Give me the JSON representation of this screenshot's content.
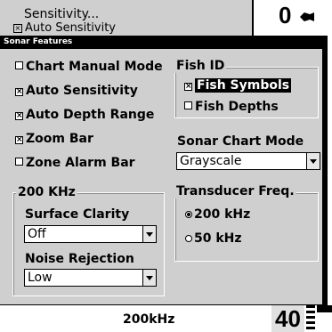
{
  "background_menu": {
    "item1": "Sensitivity...",
    "item2": "Auto Sensitivity",
    "depth_value": "0"
  },
  "dialog": {
    "title": "Sonar Features",
    "chart_manual_mode": {
      "label": "Chart Manual Mode",
      "checked": false
    },
    "auto_sensitivity": {
      "label": "Auto Sensitivity",
      "checked": true
    },
    "auto_depth_range": {
      "label": "Auto Depth Range",
      "checked": true
    },
    "zoom_bar": {
      "label": "Zoom Bar",
      "checked": true
    },
    "zone_alarm_bar": {
      "label": "Zone Alarm Bar",
      "checked": false
    },
    "fish_id": {
      "title": "Fish ID",
      "fish_symbols": {
        "label": "Fish Symbols",
        "checked": true
      },
      "fish_depths": {
        "label": "Fish Depths",
        "checked": false
      }
    },
    "sonar_chart_mode": {
      "label": "Sonar Chart Mode",
      "value": "Grayscale"
    },
    "khz200": {
      "title": "200 KHz",
      "surface_clarity": {
        "label": "Surface Clarity",
        "value": "Off"
      },
      "noise_rejection": {
        "label": "Noise Rejection",
        "value": "Low"
      }
    },
    "transducer_freq": {
      "title": "Transducer Freq.",
      "options": [
        "200 kHz",
        "50 kHz"
      ],
      "selected": "200 kHz"
    }
  },
  "status_bar": {
    "frequency": "200kHz",
    "depth": "40"
  }
}
